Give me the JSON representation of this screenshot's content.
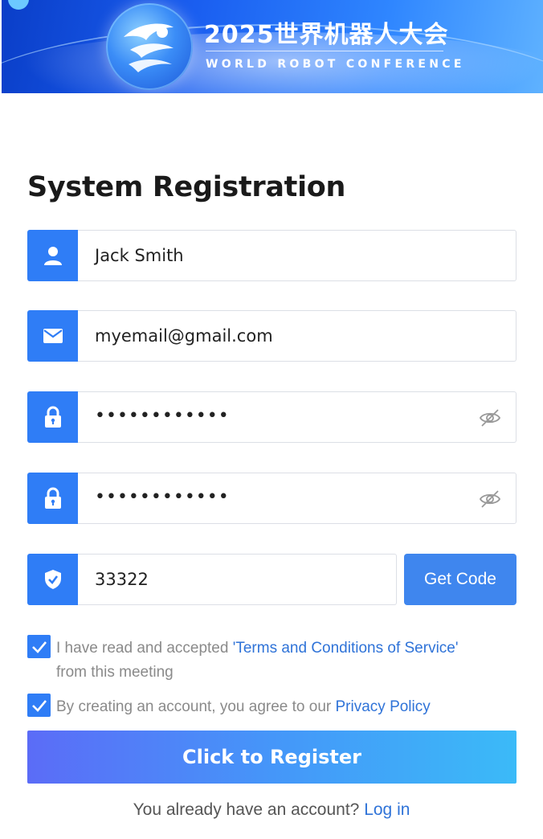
{
  "banner": {
    "title_cn": "2025世界机器人大会",
    "title_en": "WORLD ROBOT CONFERENCE",
    "logo_icon": "robot-conference-logo-icon"
  },
  "form": {
    "heading": "System Registration",
    "name": {
      "value": "Jack Smith",
      "icon": "user-icon"
    },
    "email": {
      "value": "myemail@gmail.com",
      "icon": "envelope-icon"
    },
    "password": {
      "value": "••••••••••••",
      "icon": "lock-icon",
      "toggle_icon": "eye-off-icon"
    },
    "confirm_password": {
      "value": "••••••••••••",
      "icon": "lock-icon",
      "toggle_icon": "eye-off-icon"
    },
    "code": {
      "value": "33322",
      "icon": "shield-check-icon",
      "button_label": "Get Code"
    }
  },
  "terms": {
    "checked": true,
    "text": "I have read and accepted ",
    "link": "'Terms and Conditions of Service'",
    "text_after": "from this meeting"
  },
  "privacy": {
    "checked": true,
    "text": "By creating an account, you agree to our ",
    "link": "Privacy Policy"
  },
  "register_button": "Click to Register",
  "login_prompt": {
    "text": "You already have an account? ",
    "link": "Log in"
  },
  "colors": {
    "accent": "#2f7df6",
    "link": "#2f73d8",
    "register_gradient_start": "#5b6cf7",
    "register_gradient_end": "#3bbaf8"
  }
}
